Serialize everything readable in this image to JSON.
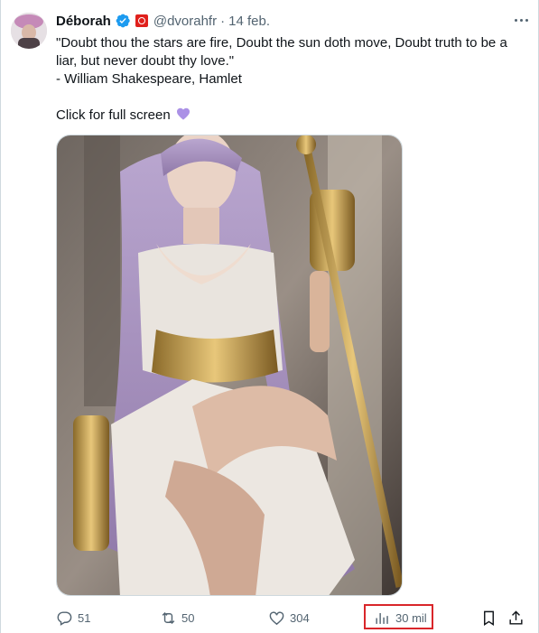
{
  "tweet": {
    "author_name": "Déborah",
    "handle": "@dvorahfr",
    "separator": "·",
    "date": "14 feb.",
    "text_line1": "\"Doubt thou the stars are fire, Doubt the sun doth move, Doubt truth to be a liar, but never doubt thy love.\"",
    "text_line2": "- William Shakespeare, Hamlet",
    "text_line3": "Click for full screen",
    "heart_emoji_color": "#ab91e6"
  },
  "actions": {
    "replies": "51",
    "retweets": "50",
    "likes": "304",
    "views": "30 mil"
  },
  "colors": {
    "text": "#0f1419",
    "secondary": "#536471",
    "verified": "#1d9bf0",
    "highlight_box": "#d9262a"
  },
  "icons": [
    "verified-badge-icon",
    "affiliation-badge-icon",
    "more-icon",
    "reply-icon",
    "retweet-icon",
    "like-icon",
    "views-icon",
    "bookmark-icon",
    "share-icon"
  ]
}
